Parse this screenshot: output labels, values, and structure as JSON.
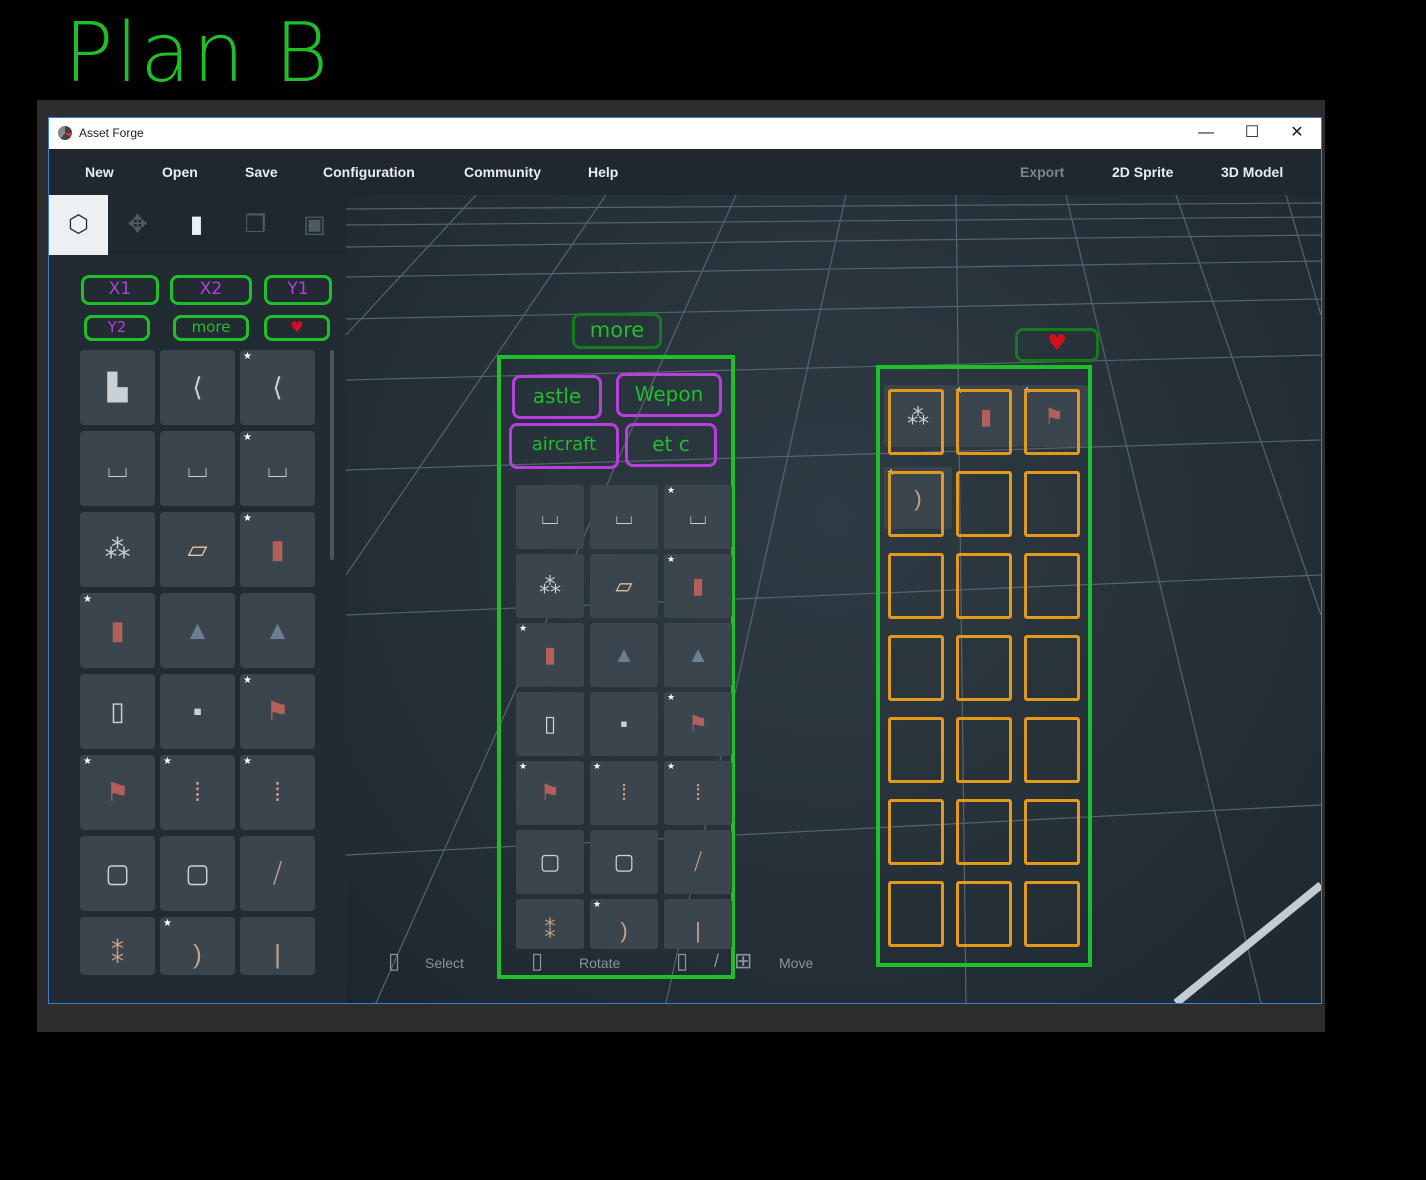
{
  "annotation": {
    "title": "Plan B",
    "sidebar_labels": [
      "X1",
      "X2",
      "Y1",
      "Y2",
      "more",
      "♥"
    ],
    "more_label": "more",
    "more_tabs": [
      "astle",
      "Wepon",
      "aircraft",
      "et c"
    ],
    "heart_label": "♥",
    "colors": {
      "green": "#1fbf2a",
      "purple": "#b73fe0",
      "orange": "#e39a1c",
      "red": "#d10f1f"
    }
  },
  "window": {
    "title": "Asset Forge",
    "controls": {
      "minimize": "—",
      "maximize": "☐",
      "close": "✕"
    }
  },
  "menu": {
    "left": [
      "New",
      "Open",
      "Save",
      "Configuration",
      "Community",
      "Help"
    ],
    "right": [
      "Export",
      "2D Sprite",
      "3D Model"
    ],
    "disabled": [
      "Export"
    ]
  },
  "tools": [
    {
      "icon": "cube-icon",
      "active": true
    },
    {
      "icon": "move-arrows-icon",
      "active": false
    },
    {
      "icon": "paint-roller-icon",
      "active": false
    },
    {
      "icon": "duplicate-icon",
      "active": false
    },
    {
      "icon": "save-disk-icon",
      "active": false
    }
  ],
  "assets": [
    {
      "icon": "castle-wall-corner-icon",
      "starred": false
    },
    {
      "icon": "castle-wall-curve-icon",
      "starred": false
    },
    {
      "icon": "castle-wall-curve-icon",
      "starred": true
    },
    {
      "icon": "battlement-icon",
      "starred": false
    },
    {
      "icon": "battlement-icon",
      "starred": false
    },
    {
      "icon": "battlement-icon",
      "starred": true
    },
    {
      "icon": "rubble-icon",
      "starred": false
    },
    {
      "icon": "wood-planks-icon",
      "starred": false
    },
    {
      "icon": "banner-icon",
      "starred": true
    },
    {
      "icon": "banner-icon",
      "starred": true
    },
    {
      "icon": "rock-icon",
      "starred": false
    },
    {
      "icon": "rock-icon",
      "starred": false
    },
    {
      "icon": "pillar-icon",
      "starred": false
    },
    {
      "icon": "block-icon",
      "starred": false
    },
    {
      "icon": "flag-icon",
      "starred": true
    },
    {
      "icon": "flag-icon",
      "starred": true
    },
    {
      "icon": "posts-icon",
      "starred": true
    },
    {
      "icon": "posts-icon",
      "starred": true
    },
    {
      "icon": "door-icon",
      "starred": false
    },
    {
      "icon": "door-icon",
      "starred": false
    },
    {
      "icon": "fence-icon",
      "starred": false
    },
    {
      "icon": "stakes-icon",
      "starred": false
    },
    {
      "icon": "bow-icon",
      "starred": true
    },
    {
      "icon": "stick-icon",
      "starred": false
    }
  ],
  "viewport": {
    "status": {
      "select": "Select",
      "rotate": "Rotate",
      "move": "Move",
      "separator": "/"
    }
  },
  "favorites_preview": [
    {
      "icon": "rubble-icon",
      "starred": false
    },
    {
      "icon": "banner-icon",
      "starred": true
    },
    {
      "icon": "flag-icon",
      "starred": true
    },
    {
      "icon": "bow-icon",
      "starred": true
    }
  ],
  "favorites_empty_slots": 17
}
